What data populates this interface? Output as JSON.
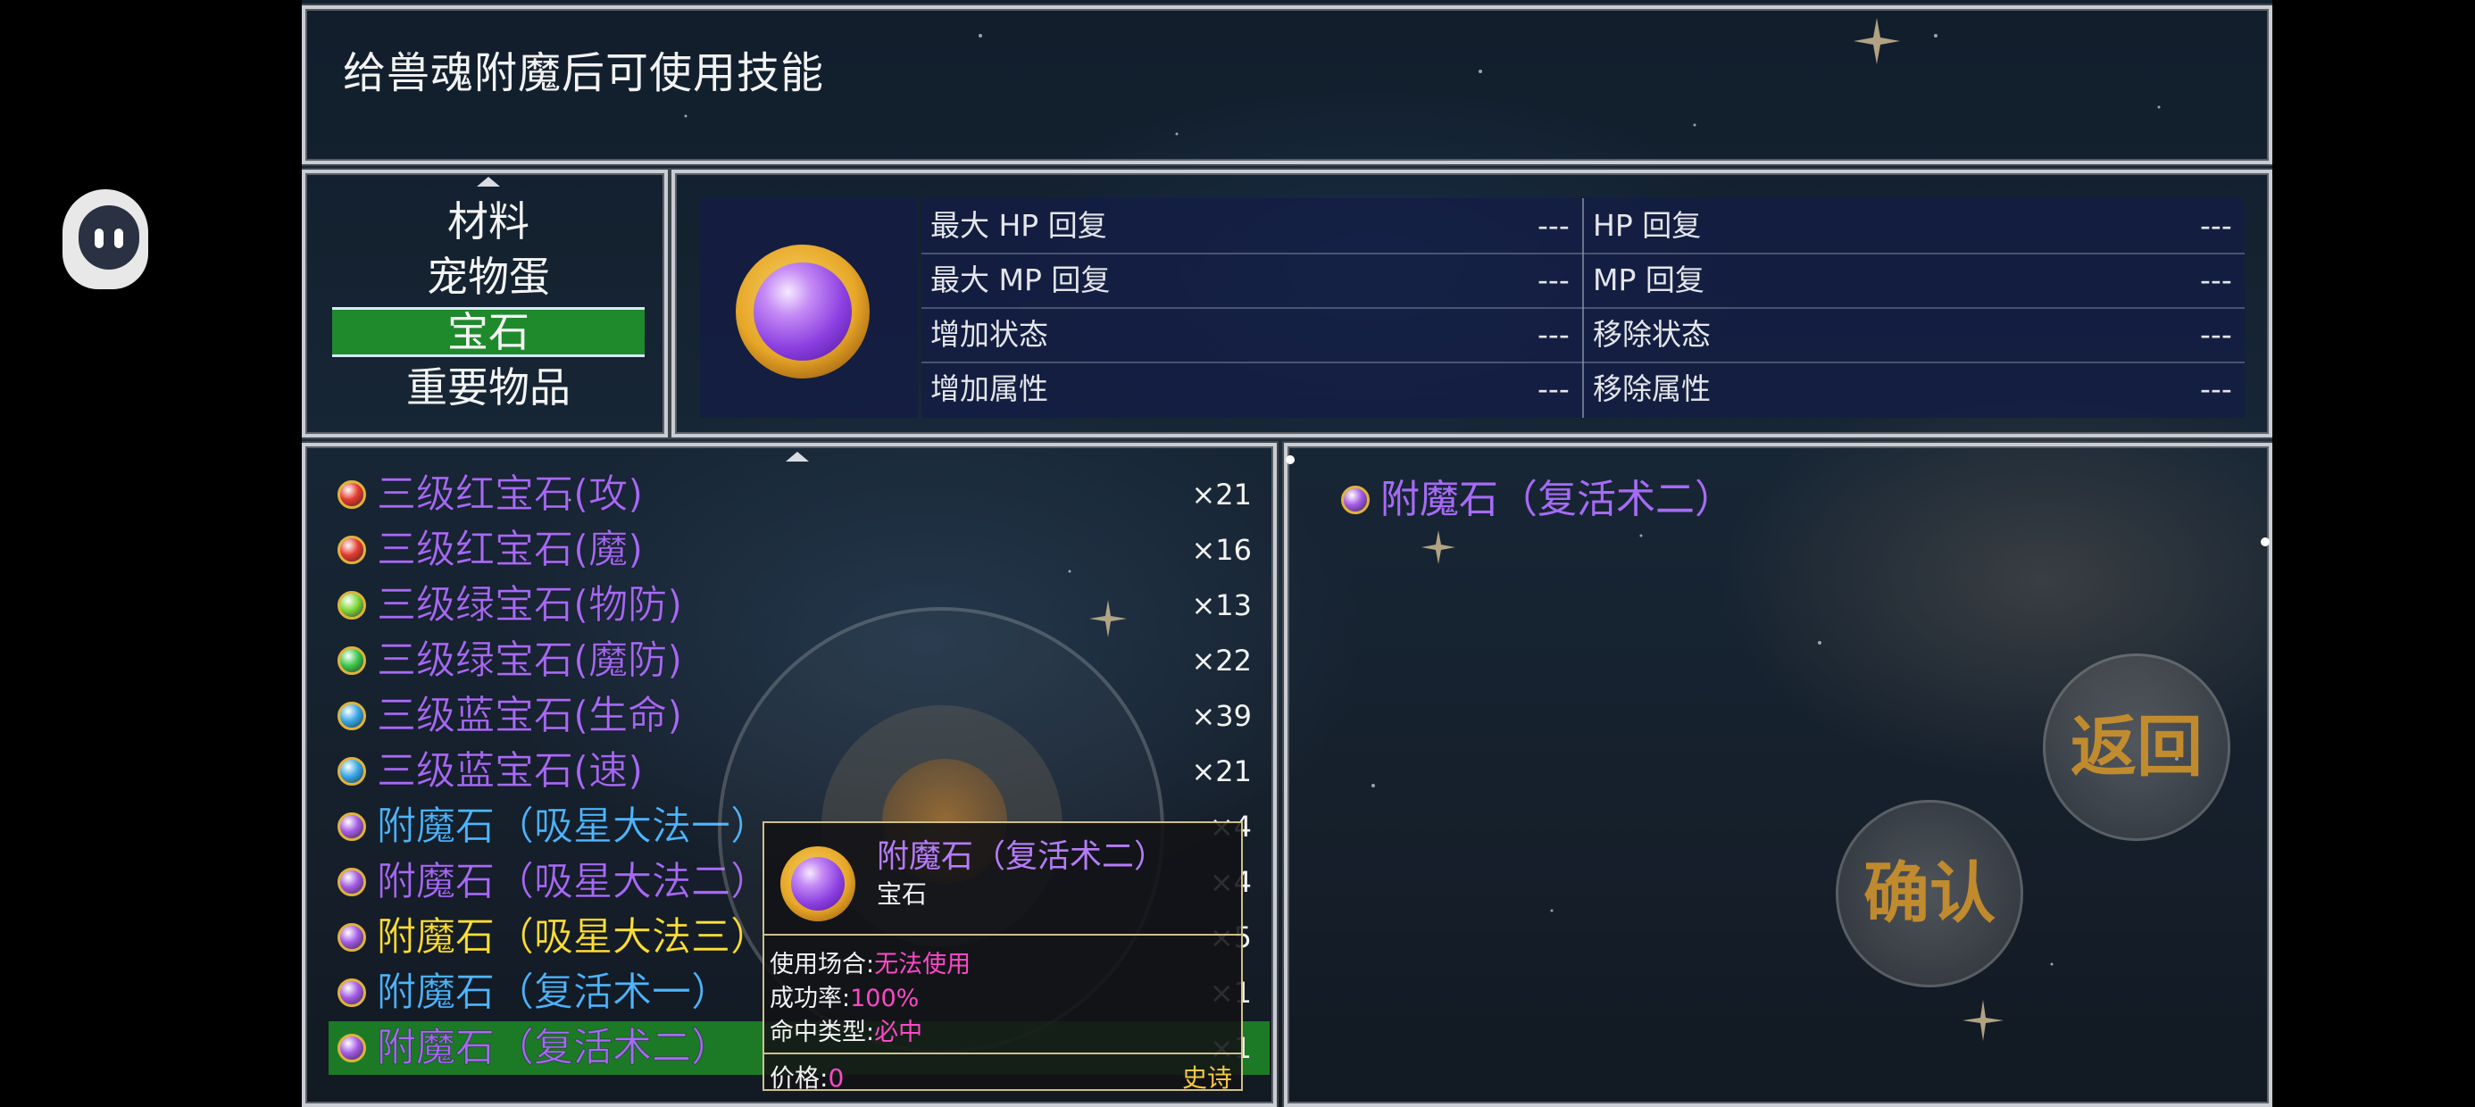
{
  "help_text": "给兽魂附魔后可使用技能",
  "categories": [
    {
      "label": "材料",
      "selected": false
    },
    {
      "label": "宠物蛋",
      "selected": false
    },
    {
      "label": "宝石",
      "selected": true
    },
    {
      "label": "重要物品",
      "selected": false
    }
  ],
  "stats": [
    {
      "left_label": "最大 HP 回复",
      "left_value": "---",
      "right_label": "HP 回复",
      "right_value": "---"
    },
    {
      "left_label": "最大 MP 回复",
      "left_value": "---",
      "right_label": "MP 回复",
      "right_value": "---"
    },
    {
      "left_label": "增加状态",
      "left_value": "---",
      "right_label": "移除状态",
      "right_value": "---"
    },
    {
      "left_label": "增加属性",
      "left_value": "---",
      "right_label": "移除属性",
      "right_value": "---"
    }
  ],
  "items": [
    {
      "name": "三级红宝石(攻)",
      "count": "×21",
      "name_color": "#a66bf5",
      "orb_color": "#e53b2f"
    },
    {
      "name": "三级红宝石(魔)",
      "count": "×16",
      "name_color": "#a66bf5",
      "orb_color": "#e53b2f"
    },
    {
      "name": "三级绿宝石(物防)",
      "count": "×13",
      "name_color": "#a66bf5",
      "orb_color": "#7fd83a"
    },
    {
      "name": "三级绿宝石(魔防)",
      "count": "×22",
      "name_color": "#a66bf5",
      "orb_color": "#3cc84a"
    },
    {
      "name": "三级蓝宝石(生命)",
      "count": "×39",
      "name_color": "#a66bf5",
      "orb_color": "#38a8e8"
    },
    {
      "name": "三级蓝宝石(速)",
      "count": "×21",
      "name_color": "#a66bf5",
      "orb_color": "#38a8e8"
    },
    {
      "name": "附魔石（吸星大法一）",
      "count": "×4",
      "name_color": "#4fb6ff",
      "orb_color": "#a45ae6"
    },
    {
      "name": "附魔石（吸星大法二）",
      "count": "×4",
      "name_color": "#a66bf5",
      "orb_color": "#a45ae6"
    },
    {
      "name": "附魔石（吸星大法三）",
      "count": "×5",
      "name_color": "#ffe13a",
      "orb_color": "#a45ae6"
    },
    {
      "name": "附魔石（复活术一）",
      "count": "×1",
      "name_color": "#4fb6ff",
      "orb_color": "#a45ae6"
    },
    {
      "name": "附魔石（复活术二）",
      "count": "×1",
      "name_color": "#a66bf5",
      "orb_color": "#a45ae6",
      "selected": true
    }
  ],
  "skill": {
    "name": "附魔石（复活术二）",
    "orb_color": "#a45ae6"
  },
  "tooltip": {
    "name": "附魔石（复活术二）",
    "type": "宝石",
    "usage_label": "使用场合:",
    "usage_value": "无法使用",
    "success_label": "成功率:",
    "success_value": "100%",
    "hit_label": "命中类型:",
    "hit_value": "必中",
    "price_label": "价格:",
    "price_value": "0",
    "rarity": "史诗"
  },
  "buttons": {
    "back": "返回",
    "confirm": "确认"
  }
}
